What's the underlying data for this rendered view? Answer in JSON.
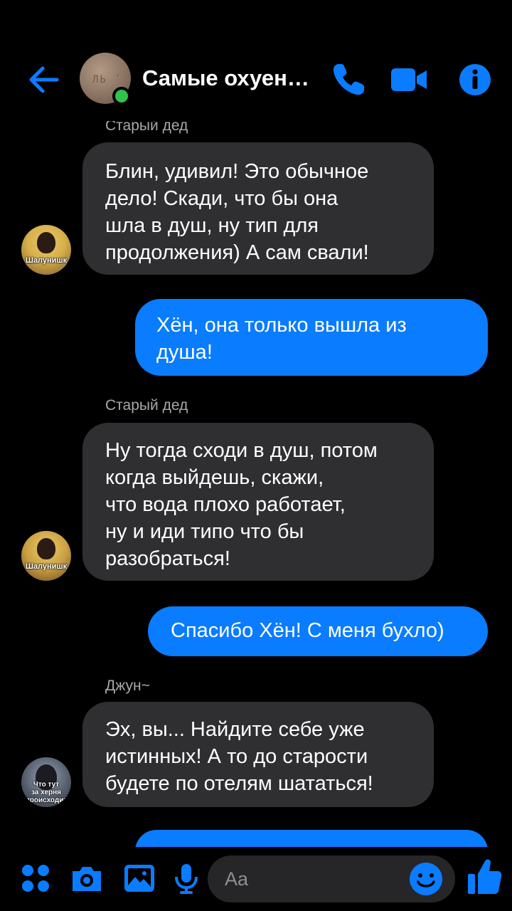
{
  "header": {
    "title": "Самые охуен…",
    "group_avatar_text": "ЛЬ ʹ"
  },
  "messages": [
    {
      "sender": "Старый дед",
      "direction": "in",
      "lines": [
        "Блин, удивил! Это обычное",
        "дело! Скади, что бы она",
        "шла в душ, ну тип для",
        "продолжения) А сам свали!"
      ],
      "avatar_caption": "Шалунишк"
    },
    {
      "direction": "out",
      "lines": [
        "Хён, она только вышла из",
        "душа!"
      ]
    },
    {
      "sender": "Старый дед",
      "direction": "in",
      "lines": [
        "Ну тогда сходи в душ, потом",
        "когда выйдешь, скажи,",
        "что вода плохо работает,",
        "ну и иди типо что бы",
        "разобраться!"
      ],
      "avatar_caption": "Шалунишк"
    },
    {
      "direction": "out",
      "lines": [
        "Спасибо Хён! С меня бухло)"
      ]
    },
    {
      "sender": "Джун~",
      "direction": "in",
      "lines": [
        "Эх, вы... Найдите себе уже",
        "истинных! А то до старости",
        "будете по отелям шататься!"
      ],
      "avatar_caption_lines": [
        "Что тут",
        "за херня",
        "происходит"
      ]
    }
  ],
  "composer": {
    "placeholder": "Aa"
  },
  "icons": {
    "back": "arrow-left-icon",
    "phone": "phone-icon",
    "video": "video-camera-icon",
    "info": "info-icon",
    "apps": "four-dots-icon",
    "camera": "camera-icon",
    "gallery": "image-icon",
    "mic": "microphone-icon",
    "emoji": "smiley-icon",
    "like": "thumbs-up-icon"
  },
  "colors": {
    "accent": "#0a7cff",
    "incoming_bubble": "#2f2f31",
    "online": "#31c24d",
    "background": "#000000"
  }
}
